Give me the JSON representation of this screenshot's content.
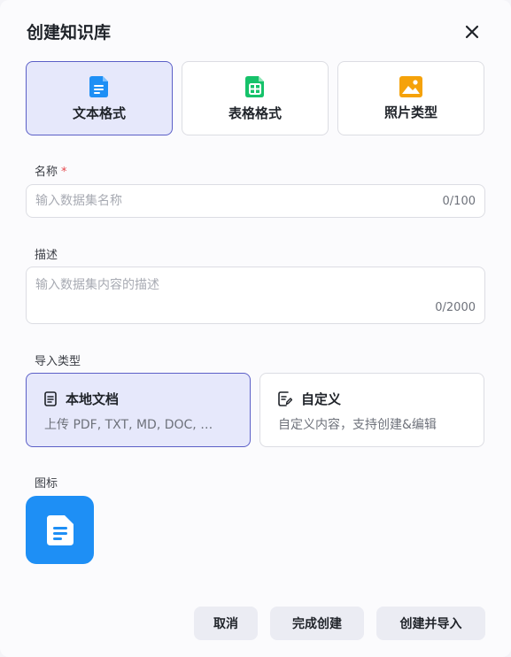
{
  "dialog": {
    "title": "创建知识库"
  },
  "format_types": [
    {
      "label": "文本格式",
      "icon": "text-doc-icon",
      "active": true
    },
    {
      "label": "表格格式",
      "icon": "table-icon",
      "active": false
    },
    {
      "label": "照片类型",
      "icon": "image-icon",
      "active": false
    }
  ],
  "name_field": {
    "label": "名称",
    "required_mark": "*",
    "placeholder": "输入数据集名称",
    "value": "",
    "counter": "0/100"
  },
  "desc_field": {
    "label": "描述",
    "placeholder": "输入数据集内容的描述",
    "value": "",
    "counter": "0/2000"
  },
  "import": {
    "label": "导入类型",
    "options": [
      {
        "title": "本地文档",
        "desc": "上传 PDF, TXT, MD, DOC, …",
        "icon": "document-icon",
        "active": true
      },
      {
        "title": "自定义",
        "desc": "自定义内容，支持创建&编辑",
        "icon": "edit-doc-icon",
        "active": false
      }
    ]
  },
  "icon_field": {
    "label": "图标",
    "icon": "document-icon"
  },
  "buttons": {
    "cancel": "取消",
    "finish": "完成创建",
    "create_import": "创建并导入"
  },
  "colors": {
    "accent": "#5b5fc7",
    "active_bg": "#e6e8fb",
    "icon_blue": "#1e8ff5",
    "table_green": "#16c26a",
    "image_orange": "#f5a20a",
    "required": "#e5484d"
  }
}
